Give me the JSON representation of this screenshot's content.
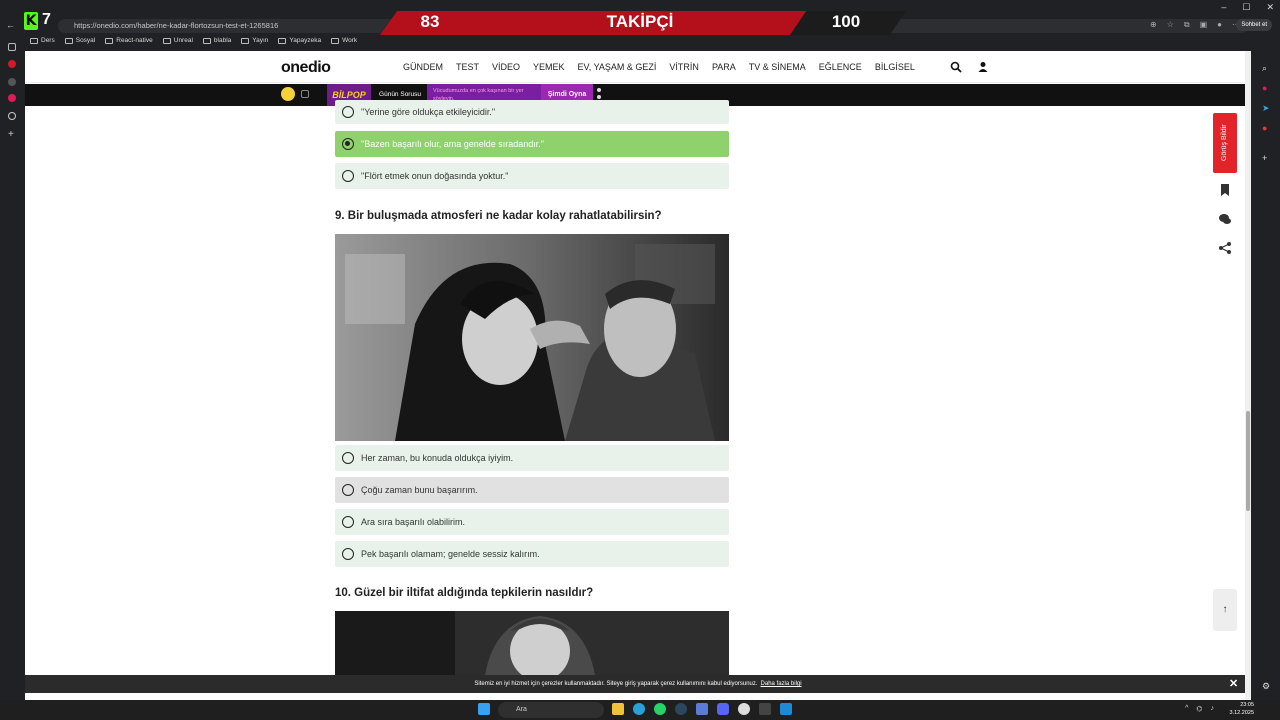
{
  "browser": {
    "url": "https://onedio.com/haber/ne-kadar-flortozsun-test-et-1265816",
    "chat_button": "Sohbet et",
    "bookmarks": [
      "Ders",
      "Sosyal",
      "React-native",
      "Unreal",
      "blabla",
      "Yayın",
      "Yapayzeka",
      "Work"
    ]
  },
  "overlay": {
    "kick_count": "7",
    "current": "83",
    "label": "TAKİPÇİ",
    "goal": "100"
  },
  "site": {
    "logo": "onedio",
    "menu": [
      "GÜNDEM",
      "TEST",
      "VİDEO",
      "YEMEK",
      "EV, YAŞAM & GEZİ",
      "VİTRİN",
      "PARA",
      "TV & SİNEMA",
      "EĞLENCE",
      "BİLGİSEL"
    ]
  },
  "promo": {
    "brand": "BİLPOP",
    "daily_label": "Günün Sorusu",
    "question": "Vücudumuzda en çok kaşınan bir yer söyleyin.",
    "play_button": "Şimdi Oyna"
  },
  "quiz": {
    "prev_options": [
      {
        "text": "\"Yerine göre oldukça etkileyicidir.\"",
        "selected": false
      },
      {
        "text": "\"Bazen başarılı olur, ama genelde sıradandır.\"",
        "selected": true
      },
      {
        "text": "\"Flört etmek onun doğasında yoktur.\"",
        "selected": false
      }
    ],
    "q9_title": "9. Bir buluşmada atmosferi ne kadar kolay rahatlatabilirsin?",
    "q9_options": [
      {
        "text": "Her zaman, bu konuda oldukça iyiyim.",
        "hover": false
      },
      {
        "text": "Çoğu zaman bunu başarırım.",
        "hover": true
      },
      {
        "text": "Ara sıra başarılı olabilirim.",
        "hover": false
      },
      {
        "text": "Pek başarılı olamam; genelde sessiz kalırım.",
        "hover": false
      }
    ],
    "q10_title": "10. Güzel bir iltifat aldığında tepkilerin nasıldır?"
  },
  "widgets": {
    "report_label": "Görüş Bildir"
  },
  "cookie": {
    "text": "Sitemiz en iyi hizmet için çerezler kullanmaktadır. Siteye giriş yaparak çerez kullanımını kabul ediyorsunuz.",
    "link": "Daha fazla bilgi"
  },
  "taskbar": {
    "search_placeholder": "Ara",
    "time": "23:05",
    "date": "3.12.2025"
  },
  "colors": {
    "selected_option": "#8ed16d",
    "option_bg": "#e9f2ea",
    "overlay_red": "#b3101b",
    "kick_green": "#53fc18",
    "promo_purple": "#7b1fa2"
  }
}
